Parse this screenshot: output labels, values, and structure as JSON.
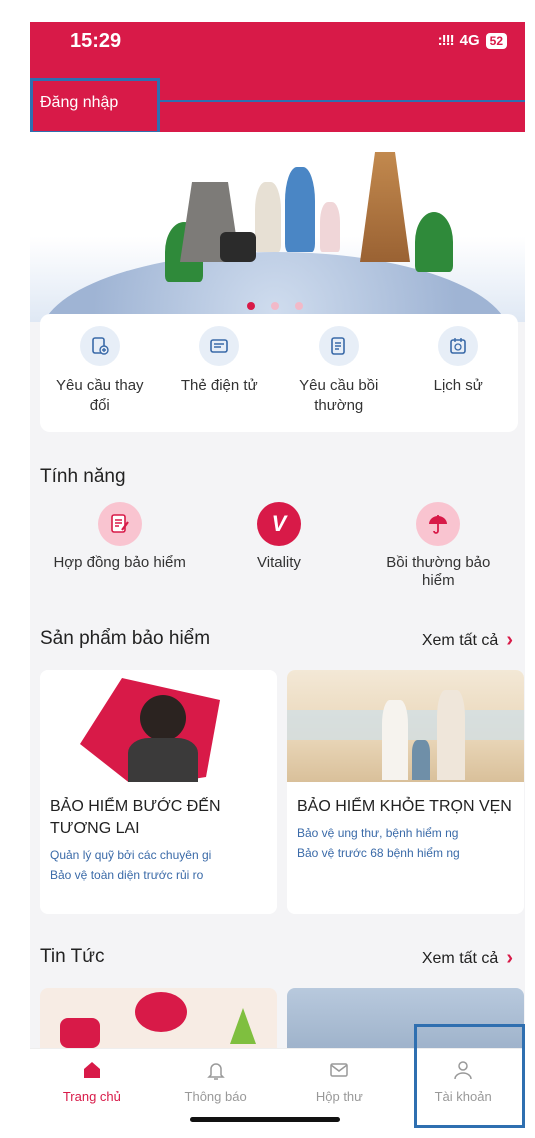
{
  "status_bar": {
    "time": "15:29",
    "signal": ":!!!",
    "network": "4G",
    "battery": "52"
  },
  "header": {
    "login_label": "Đăng nhập"
  },
  "colors": {
    "brand": "#d81a48",
    "highlight_box": "#2f6fb0",
    "link_blue": "#3a6aa8"
  },
  "banner": {
    "page_count": 3,
    "active_page": 1
  },
  "quick_actions": [
    {
      "label": "Yêu cầu thay đổi",
      "icon": "document-plus-icon"
    },
    {
      "label": "Thẻ điện tử",
      "icon": "card-icon"
    },
    {
      "label": "Yêu cầu bồi thường",
      "icon": "claim-doc-icon"
    },
    {
      "label": "Lịch sử",
      "icon": "calendar-icon"
    }
  ],
  "features": {
    "title": "Tính năng",
    "items": [
      {
        "label": "Hợp đồng bảo hiểm",
        "icon": "contract-pen-icon"
      },
      {
        "label": "Vitality",
        "icon": "vitality-v-icon"
      },
      {
        "label": "Bồi thường bảo hiểm",
        "icon": "umbrella-icon"
      }
    ]
  },
  "products": {
    "title": "Sản phẩm bảo hiểm",
    "see_all": "Xem tất cả",
    "items": [
      {
        "title": "BẢO HIỂM BƯỚC ĐẾN TƯƠNG LAI",
        "line1": "Quản lý quỹ bởi các chuyên gi",
        "line2": "Bảo vệ toàn diện trước rủi ro"
      },
      {
        "title": "BẢO HIỂM KHỎE TRỌN VẸN",
        "line1": "Bảo vệ ung thư, bệnh hiểm ng",
        "line2": "Bảo vệ trước 68 bệnh hiểm ng"
      }
    ]
  },
  "news": {
    "title": "Tin Tức",
    "see_all": "Xem tất cả"
  },
  "tabs": [
    {
      "label": "Trang chủ",
      "icon": "home-icon",
      "active": true
    },
    {
      "label": "Thông báo",
      "icon": "bell-icon",
      "active": false
    },
    {
      "label": "Hộp thư",
      "icon": "mail-icon",
      "active": false
    },
    {
      "label": "Tài khoản",
      "icon": "user-icon",
      "active": false
    }
  ]
}
